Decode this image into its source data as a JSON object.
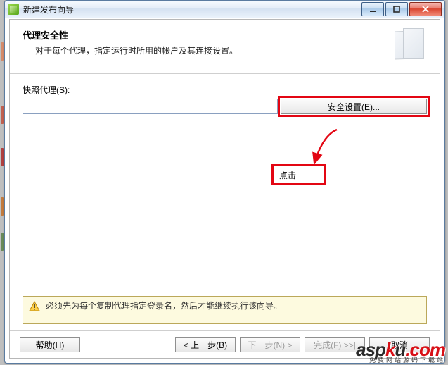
{
  "titlebar": {
    "title": "新建发布向导"
  },
  "header": {
    "heading": "代理安全性",
    "subtext": "对于每个代理，指定运行时所用的帐户及其连接设置。"
  },
  "body": {
    "snapshot_label": "快照代理(S):",
    "snapshot_value": "",
    "security_btn": "安全设置(E)..."
  },
  "annotation": {
    "callout": "点击"
  },
  "warning": {
    "text": "必须先为每个复制代理指定登录名，然后才能继续执行该向导。"
  },
  "nav": {
    "help": "帮助(H)",
    "back": "< 上一步(B)",
    "next": "下一步(N) >",
    "finish": "完成(F) >>|",
    "cancel": "取消"
  },
  "watermark": {
    "brand_a": "asp",
    "brand_k": "k",
    "brand_u": "u",
    "tld": ".com",
    "sub": "免费网站源码下载站"
  }
}
